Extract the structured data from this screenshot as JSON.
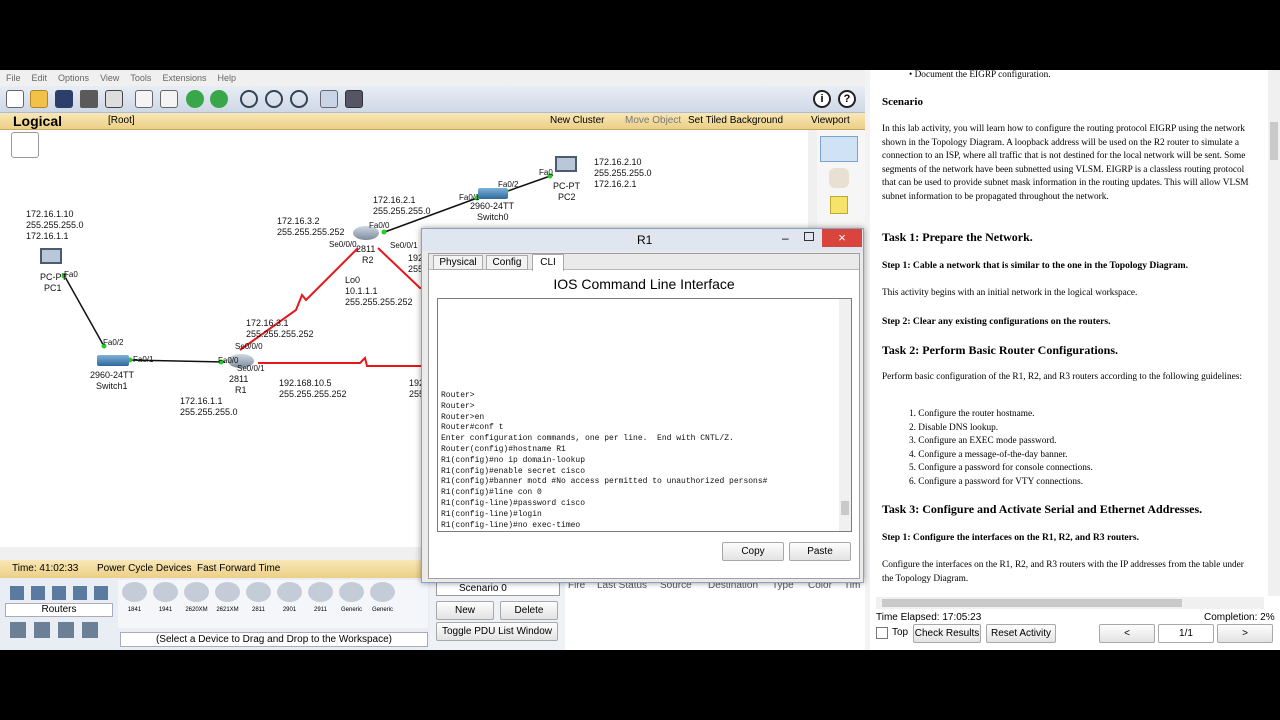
{
  "menu": [
    "File",
    "Edit",
    "Options",
    "View",
    "Tools",
    "Extensions",
    "Help"
  ],
  "nav": {
    "logical": "Logical",
    "root": "[Root]",
    "new_cluster": "New Cluster",
    "move_object": "Move Object",
    "set_tiled": "Set Tiled Background",
    "viewport": "Viewport"
  },
  "topology": {
    "pc1": {
      "name": "PC1",
      "type": "PC-PT",
      "ip": "172.16.1.10",
      "mask": "255.255.255.0",
      "gw": "172.16.1.1",
      "port": "Fa0"
    },
    "pc2": {
      "name": "PC2",
      "type": "PC-PT",
      "ip": "172.16.2.10",
      "mask": "255.255.255.0",
      "gw": "172.16.2.1",
      "port": "Fa0"
    },
    "switch1": {
      "name": "Switch1",
      "model": "2960-24TT",
      "p1": "Fa0/2",
      "p2": "Fa0/1"
    },
    "switch0": {
      "name": "Switch0",
      "model": "2960-24TT",
      "p1": "Fa0/1",
      "p2": "Fa0/2"
    },
    "r1": {
      "name": "R1",
      "model": "2811",
      "fa": "Fa0/0",
      "s0": "Se0/0/0",
      "s1": "Se0/0/1",
      "lan_ip": "172.16.1.1",
      "lan_mask": "255.255.255.0",
      "s0_ip": "172.16.3.1",
      "s0_mask": "255.255.255.252",
      "s1_ip": "192.168.10.5",
      "s1_mask": "255.255.255.252"
    },
    "r2": {
      "name": "R2",
      "model": "2811",
      "fa": "Fa0/0",
      "s0": "Se0/0/0",
      "s1": "Se0/0/1",
      "lan_ip": "172.16.2.1",
      "lan_mask": "255.255.255.0",
      "s0_ip": "172.16.3.2",
      "s0_mask": "255.255.255.252",
      "lo": "Lo0",
      "lo_ip": "10.1.1.1",
      "lo_mask": "255.255.255.252"
    },
    "cut1": "192",
    "cut2": "255",
    "cut3": "192",
    "cut4": "255"
  },
  "status": {
    "time": "Time: 41:02:33",
    "power": "Power Cycle Devices",
    "fast": "Fast Forward Time"
  },
  "devices": {
    "category": "Routers",
    "models": [
      "1841",
      "1941",
      "2620XM",
      "2621XM",
      "2811",
      "2901",
      "2911",
      "Generic",
      "Generic"
    ],
    "hint": "(Select a Device to Drag and Drop to the Workspace)"
  },
  "scenario": {
    "select": "Scenario 0",
    "new": "New",
    "delete": "Delete",
    "toggle": "Toggle PDU List Window"
  },
  "pdu_cols": [
    "Fire",
    "Last Status",
    "Source",
    "Destination",
    "Type",
    "Color",
    "Tim"
  ],
  "dialog": {
    "title": "R1",
    "tabs": [
      "Physical",
      "Config",
      "CLI"
    ],
    "heading": "IOS Command Line Interface",
    "terminal": "Router>\nRouter>\nRouter>en\nRouter#conf t\nEnter configuration commands, one per line.  End with CNTL/Z.\nRouter(config)#hostname R1\nR1(config)#no ip domain-lookup\nR1(config)#enable secret cisco\nR1(config)#banner motd #No access permitted to unauthorized persons#\nR1(config)#line con 0\nR1(config-line)#password cisco\nR1(config-line)#login\nR1(config-line)#no exec-timeo",
    "copy": "Copy",
    "paste": "Paste"
  },
  "activity": {
    "bullet": "Document the EIGRP configuration.",
    "scenario_h": "Scenario",
    "scenario_p": "In this lab activity, you will learn how to configure the routing protocol EIGRP using the network shown in the Topology Diagram. A loopback address will be used on the R2 router to simulate a connection to an ISP, where all traffic that is not destined for the local network will be sent. Some segments of the network have been subnetted using VLSM. EIGRP is a classless routing protocol that can be used to provide subnet mask information in the routing updates. This will allow VLSM subnet information to be propagated throughout the network.",
    "task1": "Task 1: Prepare the Network.",
    "t1s1": "Step 1: Cable a network that is similar to the one in the Topology Diagram.",
    "t1s1p": "This activity begins with an initial network in the logical workspace.",
    "t1s2": "Step 2: Clear any existing configurations on the routers.",
    "task2": "Task 2: Perform Basic Router Configurations.",
    "task2p": "Perform basic configuration of the R1, R2, and R3 routers according to the following guidelines:",
    "list": [
      "Configure the router hostname.",
      "Disable DNS lookup.",
      "Configure an EXEC mode password.",
      "Configure a message-of-the-day banner.",
      "Configure a password for console connections.",
      "Configure a password for VTY connections."
    ],
    "task3": "Task 3: Configure and Activate Serial and Ethernet Addresses.",
    "t3s1": "Step 1: Configure the interfaces on the R1, R2, and R3 routers.",
    "t3s1p": "Configure the interfaces on the R1, R2, and R3 routers with the IP addresses from the table under the Topology Diagram.",
    "elapsed": "Time Elapsed: 17:05:23",
    "completion": "Completion: 2%",
    "top": "Top",
    "check": "Check Results",
    "reset": "Reset Activity",
    "prev": "<",
    "page": "1/1",
    "next": ">"
  },
  "colors": {
    "serial": "#e8161b",
    "ethernet": "#111111",
    "link_up": "#1fd11f",
    "nav_bg": "#f0d88e",
    "accent": "#1a73c9"
  }
}
